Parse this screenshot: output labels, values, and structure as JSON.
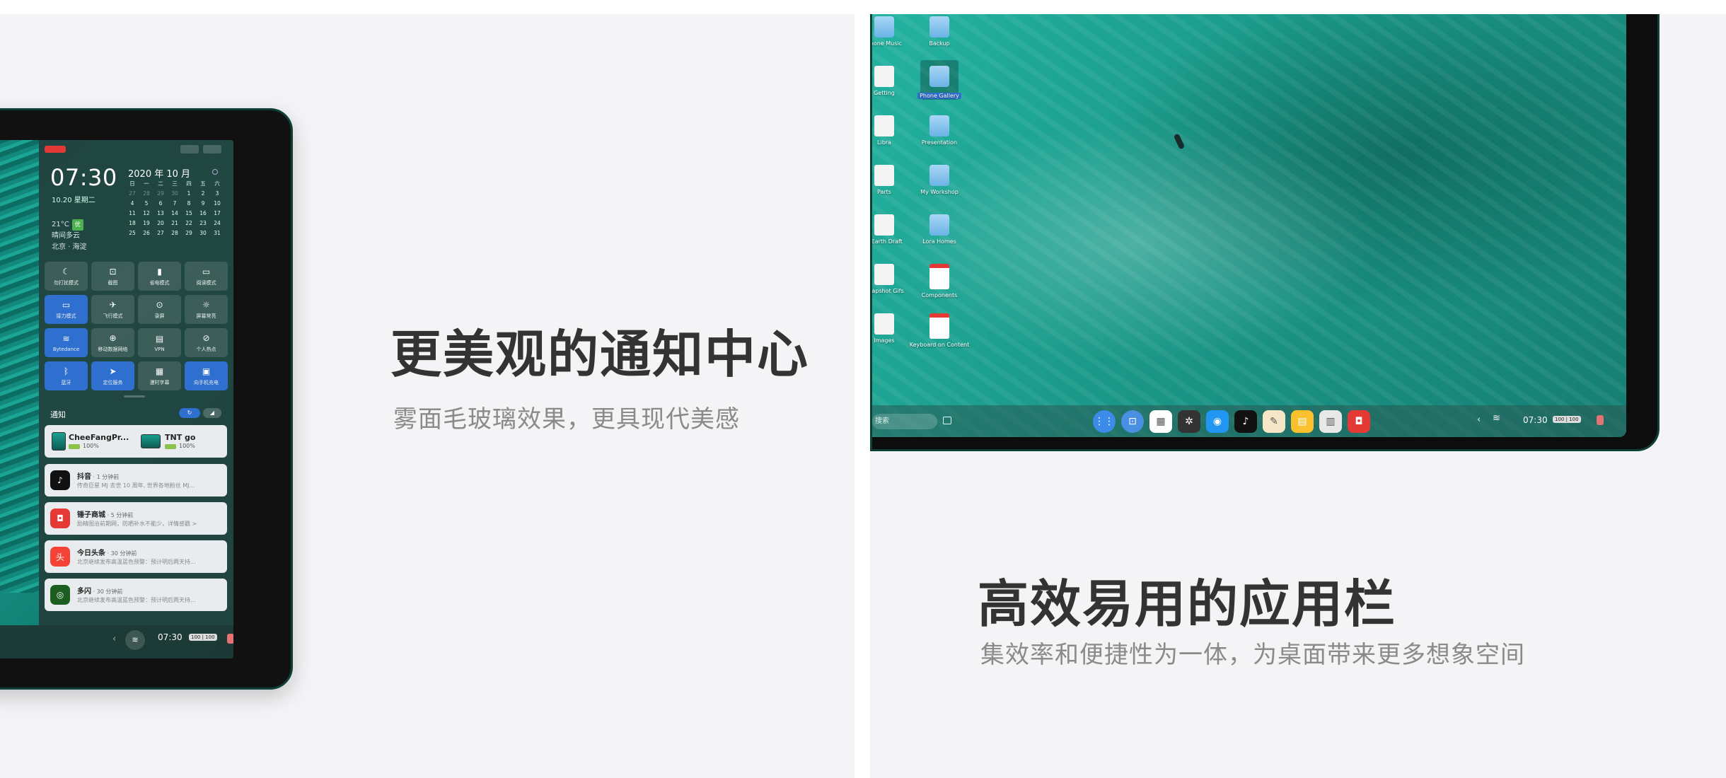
{
  "left_panel": {
    "headline": "更美观的通知中心",
    "subheadline": "雾面毛玻璃效果，更具现代美感",
    "notification_center": {
      "time": "07:30",
      "date": "10.20 星期二",
      "temperature": "21°C",
      "aqi": "优",
      "weather_desc": "晴间多云",
      "location": "北京 · 海淀",
      "calendar": {
        "title": "2020 年 10 月",
        "weekdays": [
          "日",
          "一",
          "二",
          "三",
          "四",
          "五",
          "六"
        ],
        "days": [
          "27",
          "28",
          "29",
          "30",
          "1",
          "2",
          "3",
          "4",
          "5",
          "6",
          "7",
          "8",
          "9",
          "10",
          "11",
          "12",
          "13",
          "14",
          "15",
          "16",
          "17",
          "18",
          "19",
          "20",
          "21",
          "22",
          "23",
          "24",
          "25",
          "26",
          "27",
          "28",
          "29",
          "30",
          "31"
        ]
      },
      "quick_settings": [
        {
          "label": "勿打扰模式",
          "icon": "moon-icon",
          "active": false,
          "glyph": "☾"
        },
        {
          "label": "截图",
          "icon": "screenshot-icon",
          "active": false,
          "glyph": "⊡"
        },
        {
          "label": "省电模式",
          "icon": "battery-saver-icon",
          "active": false,
          "glyph": "▮"
        },
        {
          "label": "阅读模式",
          "icon": "reading-mode-icon",
          "active": false,
          "glyph": "▭"
        },
        {
          "label": "接力模式",
          "icon": "relay-icon",
          "active": true,
          "glyph": "▭"
        },
        {
          "label": "飞行模式",
          "icon": "airplane-icon",
          "active": false,
          "glyph": "✈"
        },
        {
          "label": "录屏",
          "icon": "screen-record-icon",
          "active": false,
          "glyph": "⊙"
        },
        {
          "label": "屏幕常亮",
          "icon": "brightness-icon",
          "active": false,
          "glyph": "☼"
        },
        {
          "label": "Bytedance",
          "icon": "wifi-icon",
          "active": true,
          "glyph": "≋"
        },
        {
          "label": "移动数据网络",
          "icon": "mobile-data-icon",
          "active": false,
          "glyph": "⊕"
        },
        {
          "label": "VPN",
          "icon": "vpn-icon",
          "active": false,
          "glyph": "▤"
        },
        {
          "label": "个人热点",
          "icon": "hotspot-icon",
          "active": false,
          "glyph": "⊘"
        },
        {
          "label": "蓝牙",
          "icon": "bluetooth-icon",
          "active": true,
          "glyph": "ᛒ"
        },
        {
          "label": "定位服务",
          "icon": "location-icon",
          "active": true,
          "glyph": "➤"
        },
        {
          "label": "漫时字幕",
          "icon": "caption-icon",
          "active": false,
          "glyph": "▦"
        },
        {
          "label": "向手机充电",
          "icon": "phone-charge-icon",
          "active": true,
          "glyph": "▣"
        }
      ],
      "notifications_label": "通知",
      "devices": [
        {
          "name": "CheeFangPr...",
          "battery": "100%"
        },
        {
          "name": "TNT go",
          "battery": "100%"
        }
      ],
      "notifications": [
        {
          "app": "抖音",
          "ago": " · 1 分钟前",
          "body": "传奇巨星 MJ 去世 10 周年, 世界各地粉丝 MJ...",
          "icon": "douyin-icon",
          "color": "#111",
          "glyph": "♪"
        },
        {
          "app": "锤子商城",
          "ago": " · 5 分钟前",
          "body": "励精图治前期网，防晒补水不能少，详情感戳 >",
          "icon": "smartisan-store-icon",
          "color": "#e53935",
          "glyph": "◘"
        },
        {
          "app": "今日头条",
          "ago": " · 30 分钟前",
          "body": "北京继续发布高温蓝色预警：预计明后两天持...",
          "icon": "toutiao-icon",
          "color": "#f44336",
          "glyph": "头"
        },
        {
          "app": "多闪",
          "ago": " · 30 分钟前",
          "body": "北京继续发布高温蓝色预警：预计明后两天持...",
          "icon": "duoshan-icon",
          "color": "#1b5e20",
          "glyph": "◎"
        }
      ],
      "taskbar": {
        "time": "07:30",
        "battery": "100 | 100"
      }
    }
  },
  "right_panel": {
    "headline": "高效易用的应用栏",
    "subheadline": "集效率和便捷性为一体，为桌面带来更多想象空间",
    "desktop_icons": [
      {
        "label": "Phone Music",
        "kind": "folder"
      },
      {
        "label": "Backup",
        "kind": "folder"
      },
      {
        "label": "Getting",
        "kind": "doc"
      },
      {
        "label": "Phone Gallery",
        "kind": "folder",
        "selected": true
      },
      {
        "label": "Libra",
        "kind": "doc"
      },
      {
        "label": "Presentation",
        "kind": "folder"
      },
      {
        "label": "Parts",
        "kind": "doc"
      },
      {
        "label": "My Workshop",
        "kind": "folder"
      },
      {
        "label": "e Earth Draft",
        "kind": "doc"
      },
      {
        "label": "Lora Homes",
        "kind": "folder"
      },
      {
        "label": "Snapshot Gifs",
        "kind": "doc"
      },
      {
        "label": "Components",
        "kind": "pdf"
      },
      {
        "label": "Images",
        "kind": "doc"
      },
      {
        "label": "Keyboard on Content",
        "kind": "pdf"
      }
    ],
    "dock": {
      "search_placeholder": "搜索",
      "apps": [
        {
          "name": "launcher-icon",
          "color": "#3d8be8",
          "glyph": "⋮⋮"
        },
        {
          "name": "app-store-icon",
          "color": "#4a90e2",
          "glyph": "⊡"
        },
        {
          "name": "calendar-app-icon",
          "color": "#ffffff",
          "glyph": "▦"
        },
        {
          "name": "mercedes-icon",
          "color": "#333333",
          "glyph": "✲"
        },
        {
          "name": "browser-icon",
          "color": "#2196f3",
          "glyph": "◉"
        },
        {
          "name": "tiktok-icon",
          "color": "#111111",
          "glyph": "♪"
        },
        {
          "name": "notes-icon",
          "color": "#f5e6c8",
          "glyph": "✎"
        },
        {
          "name": "gallery-icon",
          "color": "#fbc02d",
          "glyph": "▤"
        },
        {
          "name": "files-icon",
          "color": "#e8e8e8",
          "glyph": "▥"
        },
        {
          "name": "store-icon",
          "color": "#e53935",
          "glyph": "◘"
        }
      ],
      "time": "07:30",
      "battery": "100 | 100"
    }
  }
}
